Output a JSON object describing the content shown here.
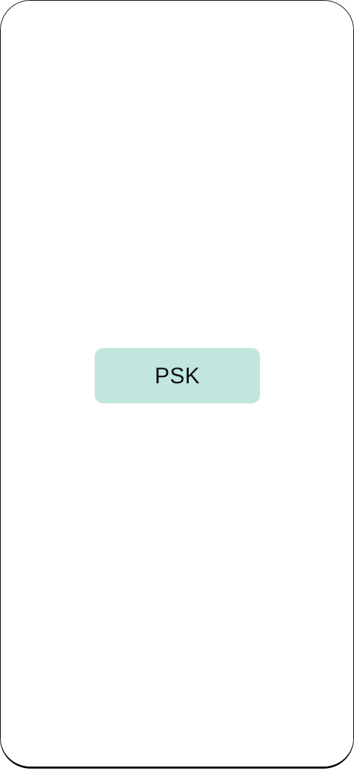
{
  "main": {
    "psk_button_label": "PSK"
  },
  "colors": {
    "button_background": "#c0e6de",
    "screen_background": "#ffffff",
    "frame": "#000000"
  }
}
